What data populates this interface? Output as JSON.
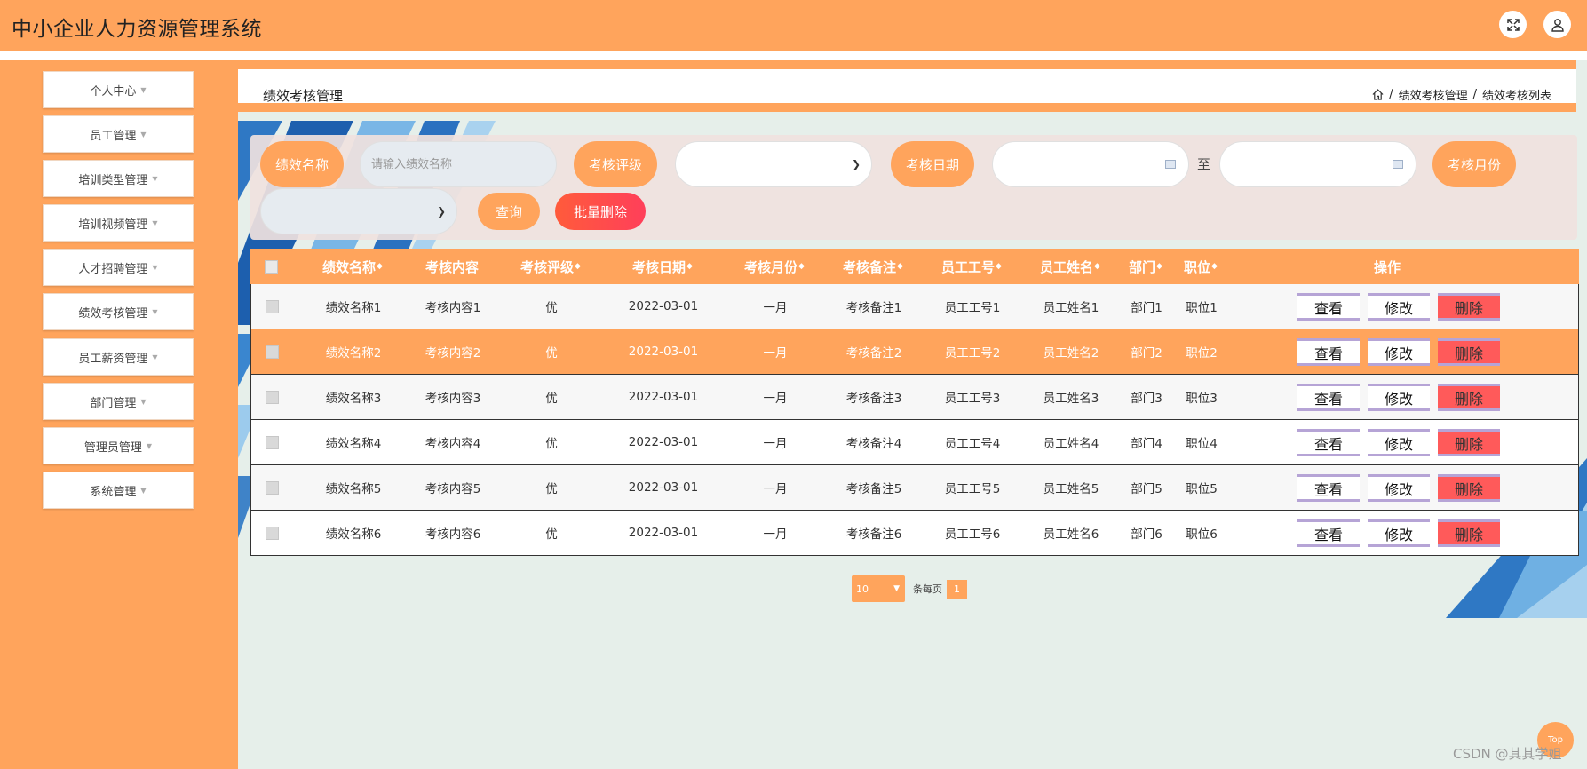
{
  "header": {
    "title": "中小企业人力资源管理系统",
    "fullscreen_icon": "expand-icon",
    "user_icon": "user-icon"
  },
  "sidebar": {
    "items": [
      {
        "label": "个人中心"
      },
      {
        "label": "员工管理"
      },
      {
        "label": "培训类型管理"
      },
      {
        "label": "培训视频管理"
      },
      {
        "label": "人才招聘管理"
      },
      {
        "label": "绩效考核管理"
      },
      {
        "label": "员工薪资管理"
      },
      {
        "label": "部门管理"
      },
      {
        "label": "管理员管理"
      },
      {
        "label": "系统管理"
      }
    ]
  },
  "page": {
    "title": "绩效考核管理",
    "breadcrumb": {
      "home_icon": "home-icon",
      "sep": "/",
      "item1": "绩效考核管理",
      "item2": "绩效考核列表"
    }
  },
  "search": {
    "name_label": "绩效名称",
    "name_placeholder": "请输入绩效名称",
    "name_value": "",
    "grade_label": "考核评级",
    "grade_value": "",
    "date_label": "考核日期",
    "date_from": "",
    "date_to": "",
    "date_sep": "至",
    "month_label": "考核月份",
    "month_value": "",
    "query_label": "查询",
    "batch_delete_label": "批量删除"
  },
  "table": {
    "headers": {
      "name": "绩效名称",
      "content": "考核内容",
      "grade": "考核评级",
      "date": "考核日期",
      "month": "考核月份",
      "remark": "考核备注",
      "emp_no": "员工工号",
      "emp_name": "员工姓名",
      "dept": "部门",
      "position": "职位",
      "actions": "操作"
    },
    "sort_glyph": "◆",
    "rows": [
      {
        "name": "绩效名称1",
        "content": "考核内容1",
        "grade": "优",
        "date": "2022-03-01",
        "month": "一月",
        "remark": "考核备注1",
        "emp_no": "员工工号1",
        "emp_name": "员工姓名1",
        "dept": "部门1",
        "position": "职位1"
      },
      {
        "name": "绩效名称2",
        "content": "考核内容2",
        "grade": "优",
        "date": "2022-03-01",
        "month": "一月",
        "remark": "考核备注2",
        "emp_no": "员工工号2",
        "emp_name": "员工姓名2",
        "dept": "部门2",
        "position": "职位2"
      },
      {
        "name": "绩效名称3",
        "content": "考核内容3",
        "grade": "优",
        "date": "2022-03-01",
        "month": "一月",
        "remark": "考核备注3",
        "emp_no": "员工工号3",
        "emp_name": "员工姓名3",
        "dept": "部门3",
        "position": "职位3"
      },
      {
        "name": "绩效名称4",
        "content": "考核内容4",
        "grade": "优",
        "date": "2022-03-01",
        "month": "一月",
        "remark": "考核备注4",
        "emp_no": "员工工号4",
        "emp_name": "员工姓名4",
        "dept": "部门4",
        "position": "职位4"
      },
      {
        "name": "绩效名称5",
        "content": "考核内容5",
        "grade": "优",
        "date": "2022-03-01",
        "month": "一月",
        "remark": "考核备注5",
        "emp_no": "员工工号5",
        "emp_name": "员工姓名5",
        "dept": "部门5",
        "position": "职位5"
      },
      {
        "name": "绩效名称6",
        "content": "考核内容6",
        "grade": "优",
        "date": "2022-03-01",
        "month": "一月",
        "remark": "考核备注6",
        "emp_no": "员工工号6",
        "emp_name": "员工姓名6",
        "dept": "部门6",
        "position": "职位6"
      }
    ],
    "actions": {
      "view": "查看",
      "edit": "修改",
      "delete": "删除"
    }
  },
  "pagination": {
    "page_size": "10",
    "per_page_label": "条每页",
    "current_page": "1"
  },
  "back_to_top": "Top",
  "watermark": "CSDN @其其学姐",
  "colors": {
    "accent": "#ffa45c",
    "danger": "#ff5a5a",
    "batch_delete": "#ff4a4a",
    "background": "#e6efea"
  }
}
